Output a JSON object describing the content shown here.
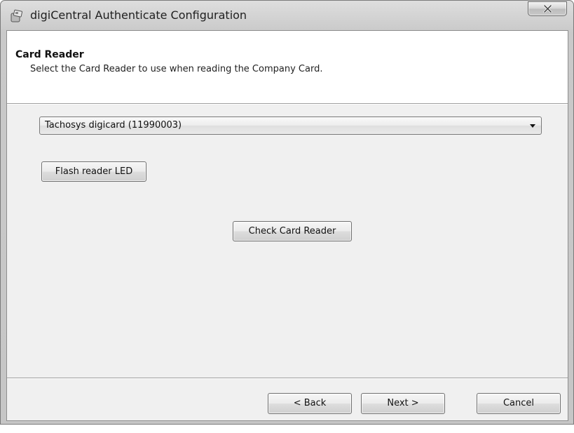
{
  "window": {
    "title": "digiCentral Authenticate Configuration",
    "icon": "card-reader-app-icon",
    "close_icon": "close-x-icon"
  },
  "header": {
    "title": "Card Reader",
    "subtitle": "Select the Card Reader to use when reading the Company Card."
  },
  "reader_select": {
    "selected": "Tachosys digicard (11990003)"
  },
  "buttons": {
    "flash": "Flash reader LED",
    "check": "Check Card Reader",
    "back": "< Back",
    "next": "Next >",
    "cancel": "Cancel"
  }
}
